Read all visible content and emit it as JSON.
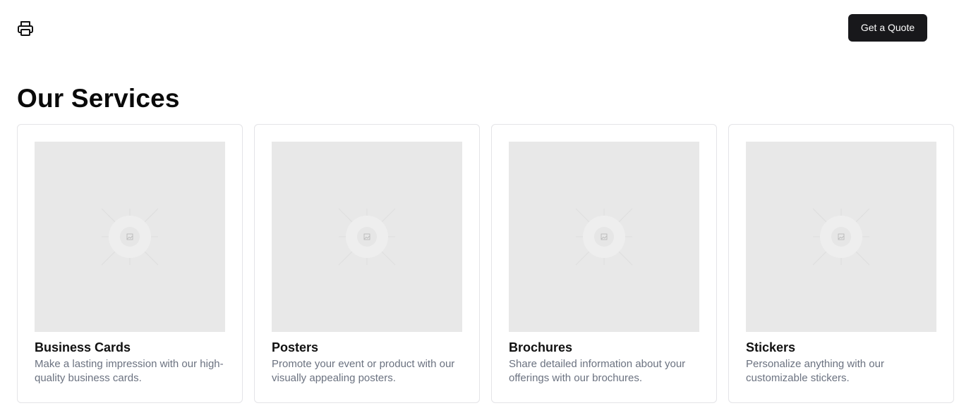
{
  "header": {
    "logo_icon": "printer-icon",
    "cta_label": "Get a Quote",
    "cta_color": "#18181b"
  },
  "services": {
    "title": "Our Services",
    "items": [
      {
        "title": "Business Cards",
        "description": "Make a lasting impression with our high-quality business cards.",
        "image_icon": "image-placeholder-icon"
      },
      {
        "title": "Posters",
        "description": "Promote your event or product with our visually appealing posters.",
        "image_icon": "image-placeholder-icon"
      },
      {
        "title": "Brochures",
        "description": "Share detailed information about your offerings with our brochures.",
        "image_icon": "image-placeholder-icon"
      },
      {
        "title": "Stickers",
        "description": "Personalize anything with our customizable stickers.",
        "image_icon": "image-placeholder-icon"
      }
    ]
  }
}
